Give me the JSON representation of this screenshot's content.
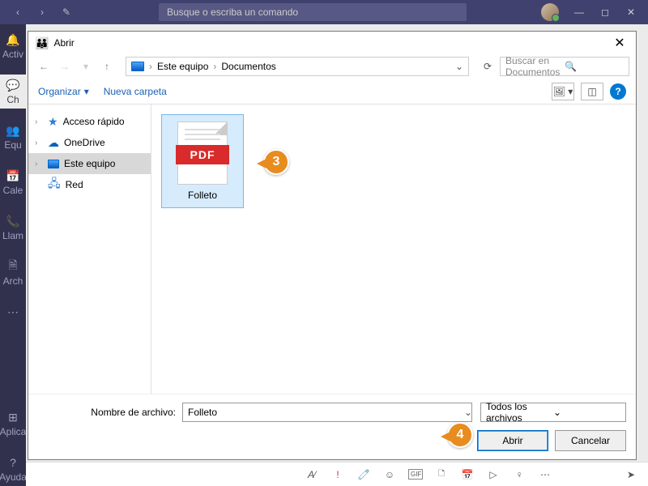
{
  "titlebar": {
    "search_placeholder": "Busque o escriba un comando"
  },
  "rail": {
    "i0": "Activ",
    "i1": "Ch",
    "i2": "Equ",
    "i3": "Cale",
    "i4": "Llam",
    "i5": "Arch",
    "apps": "Aplica",
    "help": "Ayuda"
  },
  "dialog": {
    "title": "Abrir",
    "breadcrumb": {
      "root": "Este equipo",
      "folder": "Documentos"
    },
    "search_placeholder": "Buscar en Documentos",
    "toolbar": {
      "organize": "Organizar",
      "new_folder": "Nueva carpeta"
    },
    "tree": {
      "quick": "Acceso rápido",
      "onedrive": "OneDrive",
      "thispc": "Este equipo",
      "network": "Red"
    },
    "file": {
      "name": "Folleto",
      "badge": "PDF"
    },
    "filename_label": "Nombre de archivo:",
    "filename_value": "Folleto",
    "filter": "Todos los archivos",
    "open": "Abrir",
    "cancel": "Cancelar"
  },
  "callouts": {
    "c3": "3",
    "c4": "4"
  }
}
